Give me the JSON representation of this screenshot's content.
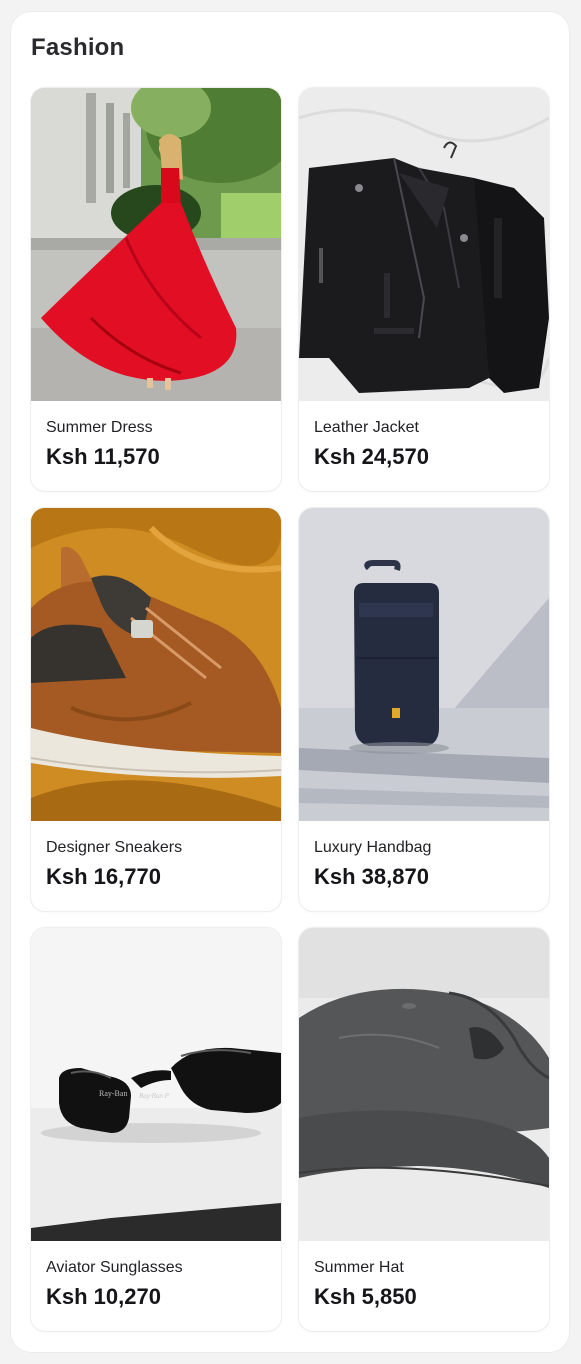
{
  "section": {
    "title": "Fashion"
  },
  "products": [
    {
      "name": "Summer Dress",
      "price": "Ksh 11,570",
      "image": "red-dress-photo"
    },
    {
      "name": "Leather Jacket",
      "price": "Ksh 24,570",
      "image": "leather-jacket-photo"
    },
    {
      "name": "Designer Sneakers",
      "price": "Ksh 16,770",
      "image": "sneaker-photo"
    },
    {
      "name": "Luxury Handbag",
      "price": "Ksh 38,870",
      "image": "backpack-photo"
    },
    {
      "name": "Aviator Sunglasses",
      "price": "Ksh 10,270",
      "image": "sunglasses-photo"
    },
    {
      "name": "Summer Hat",
      "price": "Ksh 5,850",
      "image": "cap-photo"
    }
  ]
}
